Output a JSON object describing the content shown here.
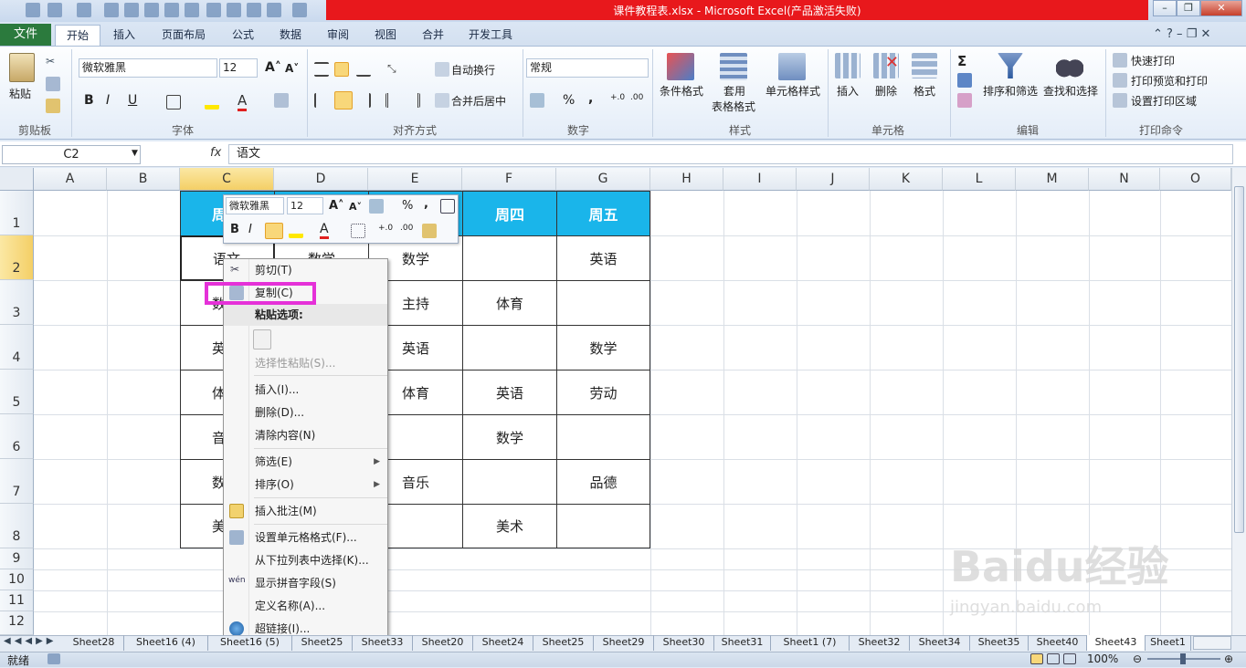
{
  "window": {
    "title": "课件教程表.xlsx - Microsoft Excel(产品激活失败)"
  },
  "tabs": [
    "文件",
    "开始",
    "插入",
    "页面布局",
    "公式",
    "数据",
    "审阅",
    "视图",
    "合并",
    "开发工具"
  ],
  "ribbon": {
    "clipboard": {
      "paste": "粘贴",
      "group": "剪贴板"
    },
    "font": {
      "name": "微软雅黑",
      "size": "12",
      "group": "字体",
      "bold": "B",
      "italic": "I",
      "underline": "U"
    },
    "align": {
      "wrap": "自动换行",
      "merge": "合并后居中",
      "group": "对齐方式"
    },
    "number": {
      "format": "常规",
      "group": "数字",
      "percent": "%",
      "comma": ","
    },
    "styles": {
      "cond": "条件格式",
      "table1": "套用",
      "table2": "表格格式",
      "cell": "单元格样式",
      "group": "样式"
    },
    "cells": {
      "insert": "插入",
      "delete": "删除",
      "format": "格式",
      "group": "单元格"
    },
    "edit": {
      "sum": "Σ",
      "sort": "排序和筛选",
      "find": "查找和选择",
      "group": "编辑"
    },
    "print": {
      "quick": "快速打印",
      "preview": "打印预览和打印",
      "area": "设置打印区域",
      "group": "打印命令"
    }
  },
  "formula": {
    "name_box": "C2",
    "fx": "fx",
    "content": "语文"
  },
  "columns": [
    "A",
    "B",
    "C",
    "D",
    "E",
    "F",
    "G",
    "H",
    "I",
    "J",
    "K",
    "L",
    "M",
    "N",
    "O"
  ],
  "rows": [
    "1",
    "2",
    "3",
    "4",
    "5",
    "6",
    "7",
    "8",
    "9",
    "10",
    "11",
    "12"
  ],
  "table": {
    "headers": [
      "周",
      "",
      "",
      "周四",
      "周五"
    ],
    "cells": [
      [
        "语文",
        "数学",
        "数学",
        "",
        "英语"
      ],
      [
        "数",
        "",
        "主持",
        "体育",
        ""
      ],
      [
        "英",
        "",
        "英语",
        "",
        "数学"
      ],
      [
        "体",
        "",
        "体育",
        "英语",
        "劳动"
      ],
      [
        "音",
        "",
        "",
        "数学",
        ""
      ],
      [
        "数",
        "",
        "音乐",
        "",
        "品德"
      ],
      [
        "美",
        "",
        "",
        "美术",
        ""
      ]
    ]
  },
  "mini_toolbar": {
    "font": "微软雅黑",
    "size": "12",
    "percent": "%",
    "comma": ",",
    "bold": "B",
    "italic": "I",
    "font_a": "A"
  },
  "context_menu": {
    "cut": "剪切(T)",
    "copy": "复制(C)",
    "paste_options": "粘贴选项:",
    "paste_special": "选择性粘贴(S)...",
    "insert": "插入(I)...",
    "delete": "删除(D)...",
    "clear": "清除内容(N)",
    "filter": "筛选(E)",
    "sort": "排序(O)",
    "comment": "插入批注(M)",
    "format_cells": "设置单元格格式(F)...",
    "dropdown": "从下拉列表中选择(K)...",
    "pinyin": "显示拼音字段(S)",
    "define_name": "定义名称(A)...",
    "hyperlink": "超链接(I)..."
  },
  "sheets": [
    "Sheet28",
    "Sheet16 (4)",
    "Sheet16 (5)",
    "Sheet25",
    "Sheet33",
    "Sheet20",
    "Sheet24",
    "Sheet25",
    "Sheet29",
    "Sheet30",
    "Sheet31",
    "Sheet1 (7)",
    "Sheet32",
    "Sheet34",
    "Sheet35",
    "Sheet40",
    "Sheet43",
    "Sheet1"
  ],
  "status": {
    "ready": "就绪",
    "zoom": "100%"
  },
  "watermark": {
    "text": "Baidu经验",
    "sub": "jingyan.baidu.com"
  }
}
